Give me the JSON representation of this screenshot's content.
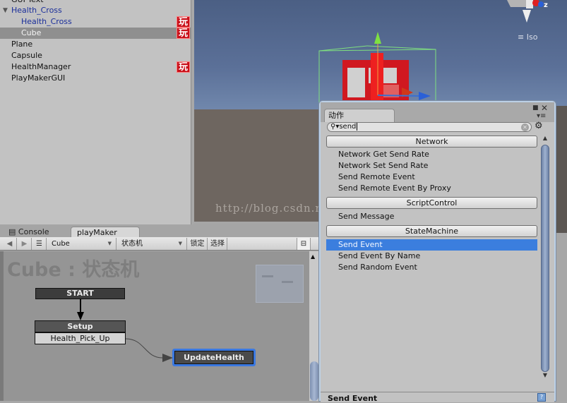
{
  "hierarchy": {
    "items": [
      {
        "label": "GUI Text",
        "indent": 0,
        "selected": false,
        "color": "black"
      },
      {
        "label": "Health_Cross",
        "indent": 0,
        "expanded": true,
        "color": "blue"
      },
      {
        "label": "Health_Cross",
        "indent": 1,
        "color": "blue",
        "badge": "玩"
      },
      {
        "label": "Cube",
        "indent": 1,
        "selected": true,
        "badge": "玩"
      },
      {
        "label": "Plane",
        "indent": 0
      },
      {
        "label": "Capsule",
        "indent": 0
      },
      {
        "label": "HealthManager",
        "indent": 0,
        "badge": "玩"
      },
      {
        "label": "PlayMakerGUI",
        "indent": 0
      }
    ]
  },
  "scene": {
    "projection_label": "Iso",
    "gizmo_axis_label": "z",
    "watermark": "http://blog.csdn.net/"
  },
  "bottom_panel": {
    "tabs": [
      {
        "label": "Console",
        "icon": "console-icon",
        "active": false
      },
      {
        "label": "playMaker",
        "active": true
      }
    ],
    "toolbar": {
      "back_icon": "◀",
      "forward_icon": "▶",
      "menu_icon": "☰",
      "gameobject_select": "Cube",
      "fsm_select": "状态机",
      "lock_label": "锁定",
      "select_label": "选择"
    },
    "graph": {
      "title": "Cube : 状态机",
      "start_label": "START",
      "states": [
        {
          "name": "Setup",
          "transitions": [
            "Health_Pick_Up"
          ]
        },
        {
          "name": "UpdateHealth",
          "selected": true
        }
      ]
    }
  },
  "actions_window": {
    "tab_label": "动作",
    "search_value": "send",
    "categories": [
      {
        "name": "Network",
        "items": [
          "Network Get Send Rate",
          "Network Set Send Rate",
          "Send Remote Event",
          "Send Remote Event By Proxy"
        ]
      },
      {
        "name": "ScriptControl",
        "items": [
          "Send Message"
        ]
      },
      {
        "name": "StateMachine",
        "items": [
          "Send Event",
          "Send Event By Name",
          "Send Random Event"
        ]
      }
    ],
    "selected_item": "Send Event",
    "footer_title": "Send Event",
    "accent_color": "#3b7ede"
  }
}
